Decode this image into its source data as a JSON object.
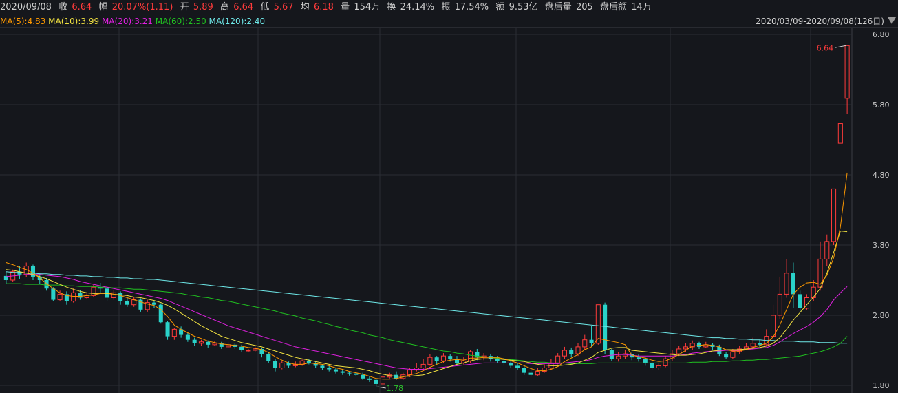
{
  "header": {
    "date": "2020/09/08",
    "close_label": "收",
    "close": "6.64",
    "chg_label": "幅",
    "chg": "20.07%(1.11)",
    "open_label": "开",
    "open": "5.89",
    "high_label": "高",
    "high": "6.64",
    "low_label": "低",
    "low": "5.67",
    "avg_label": "均",
    "avg": "6.18",
    "vol_label": "量",
    "vol": "154万",
    "turnover_label": "换",
    "turnover": "24.14%",
    "amp_label": "振",
    "amp": "17.54%",
    "amount_label": "额",
    "amount": "9.53亿",
    "after_vol_label": "盘后量",
    "after_vol": "205",
    "after_amt_label": "盘后额",
    "after_amt": "14万"
  },
  "ma_legend": [
    {
      "text": "MA(5):4.83",
      "color": "#ff9900"
    },
    {
      "text": "MA(10):3.99",
      "color": "#f0e040"
    },
    {
      "text": "MA(20):3.21",
      "color": "#e020e0"
    },
    {
      "text": "MA(60):2.50",
      "color": "#20c020"
    },
    {
      "text": "MA(120):2.40",
      "color": "#6ee8e8"
    }
  ],
  "range_label": "2020/03/09-2020/09/08(126日)",
  "colors": {
    "up": "#ff3b3b",
    "down": "#2ad2c9",
    "grid": "#2a2d34"
  },
  "chart_data": {
    "type": "candlestick",
    "ylim": [
      1.78,
      6.82
    ],
    "yticks": [
      "6.80",
      "5.80",
      "4.80",
      "3.80",
      "2.80",
      "1.80"
    ],
    "max_label": "6.64",
    "min_label": "1.78",
    "candles": [
      [
        3.36,
        3.3,
        3.42,
        3.25
      ],
      [
        3.3,
        3.42,
        3.45,
        3.28
      ],
      [
        3.42,
        3.38,
        3.5,
        3.32
      ],
      [
        3.38,
        3.5,
        3.55,
        3.34
      ],
      [
        3.5,
        3.35,
        3.52,
        3.3
      ],
      [
        3.35,
        3.3,
        3.4,
        3.25
      ],
      [
        3.3,
        3.18,
        3.33,
        3.15
      ],
      [
        3.18,
        3.02,
        3.2,
        3.0
      ],
      [
        3.02,
        3.1,
        3.15,
        3.0
      ],
      [
        3.1,
        3.0,
        3.14,
        2.95
      ],
      [
        3.0,
        3.12,
        3.18,
        2.98
      ],
      [
        3.12,
        3.05,
        3.16,
        3.02
      ],
      [
        3.05,
        3.08,
        3.12,
        3.03
      ],
      [
        3.08,
        3.2,
        3.24,
        3.06
      ],
      [
        3.2,
        3.18,
        3.26,
        3.12
      ],
      [
        3.18,
        3.05,
        3.2,
        3.0
      ],
      [
        3.05,
        3.12,
        3.16,
        3.02
      ],
      [
        3.12,
        3.0,
        3.14,
        2.95
      ],
      [
        3.0,
        2.95,
        3.05,
        2.92
      ],
      [
        2.95,
        3.02,
        3.06,
        2.92
      ],
      [
        3.02,
        2.88,
        3.04,
        2.85
      ],
      [
        2.88,
        2.98,
        3.02,
        2.85
      ],
      [
        2.98,
        2.95,
        3.0,
        2.9
      ],
      [
        2.95,
        2.7,
        2.97,
        2.68
      ],
      [
        2.7,
        2.5,
        2.72,
        2.45
      ],
      [
        2.5,
        2.6,
        2.62,
        2.45
      ],
      [
        2.6,
        2.52,
        2.64,
        2.48
      ],
      [
        2.52,
        2.45,
        2.55,
        2.42
      ],
      [
        2.45,
        2.4,
        2.48,
        2.36
      ],
      [
        2.4,
        2.42,
        2.45,
        2.36
      ],
      [
        2.42,
        2.38,
        2.44,
        2.34
      ],
      [
        2.38,
        2.4,
        2.43,
        2.36
      ],
      [
        2.4,
        2.35,
        2.42,
        2.32
      ],
      [
        2.35,
        2.38,
        2.42,
        2.33
      ],
      [
        2.38,
        2.35,
        2.4,
        2.32
      ],
      [
        2.35,
        2.3,
        2.38,
        2.28
      ],
      [
        2.3,
        2.3,
        2.32,
        2.27
      ],
      [
        2.3,
        2.32,
        2.36,
        2.28
      ],
      [
        2.32,
        2.25,
        2.34,
        2.2
      ],
      [
        2.25,
        2.15,
        2.27,
        2.12
      ],
      [
        2.15,
        2.05,
        2.18,
        2.0
      ],
      [
        2.05,
        2.12,
        2.15,
        2.03
      ],
      [
        2.12,
        2.08,
        2.14,
        2.05
      ],
      [
        2.08,
        2.1,
        2.14,
        2.06
      ],
      [
        2.1,
        2.15,
        2.17,
        2.08
      ],
      [
        2.15,
        2.12,
        2.18,
        2.1
      ],
      [
        2.12,
        2.08,
        2.14,
        2.05
      ],
      [
        2.08,
        2.05,
        2.1,
        2.02
      ],
      [
        2.05,
        2.03,
        2.08,
        2.0
      ],
      [
        2.03,
        2.0,
        2.05,
        1.97
      ],
      [
        2.0,
        1.98,
        2.02,
        1.95
      ],
      [
        1.98,
        1.97,
        2.0,
        1.94
      ],
      [
        1.97,
        1.95,
        1.99,
        1.93
      ],
      [
        1.95,
        1.9,
        1.98,
        1.88
      ],
      [
        1.9,
        1.88,
        1.93,
        1.85
      ],
      [
        1.88,
        1.82,
        1.9,
        1.78
      ],
      [
        1.82,
        1.92,
        1.95,
        1.8
      ],
      [
        1.92,
        1.95,
        1.98,
        1.9
      ],
      [
        1.95,
        1.9,
        2.0,
        1.88
      ],
      [
        1.9,
        1.95,
        1.98,
        1.88
      ],
      [
        1.95,
        2.02,
        2.05,
        1.92
      ],
      [
        2.02,
        2.05,
        2.12,
        2.0
      ],
      [
        2.05,
        2.1,
        2.18,
        2.03
      ],
      [
        2.1,
        2.2,
        2.25,
        2.08
      ],
      [
        2.2,
        2.15,
        2.22,
        2.1
      ],
      [
        2.15,
        2.22,
        2.26,
        2.12
      ],
      [
        2.22,
        2.18,
        2.25,
        2.14
      ],
      [
        2.18,
        2.12,
        2.22,
        2.08
      ],
      [
        2.12,
        2.15,
        2.2,
        2.1
      ],
      [
        2.15,
        2.28,
        2.3,
        2.12
      ],
      [
        2.28,
        2.2,
        2.32,
        2.16
      ],
      [
        2.2,
        2.22,
        2.26,
        2.16
      ],
      [
        2.22,
        2.18,
        2.25,
        2.14
      ],
      [
        2.18,
        2.15,
        2.22,
        2.12
      ],
      [
        2.15,
        2.12,
        2.18,
        2.08
      ],
      [
        2.12,
        2.08,
        2.15,
        2.05
      ],
      [
        2.08,
        2.05,
        2.12,
        2.02
      ],
      [
        2.05,
        1.98,
        2.08,
        1.95
      ],
      [
        1.98,
        1.95,
        2.02,
        1.92
      ],
      [
        1.95,
        2.0,
        2.05,
        1.93
      ],
      [
        2.0,
        2.05,
        2.1,
        1.98
      ],
      [
        2.05,
        2.12,
        2.18,
        2.03
      ],
      [
        2.12,
        2.22,
        2.26,
        2.1
      ],
      [
        2.22,
        2.3,
        2.35,
        2.18
      ],
      [
        2.3,
        2.25,
        2.34,
        2.2
      ],
      [
        2.25,
        2.35,
        2.4,
        2.22
      ],
      [
        2.35,
        2.45,
        2.52,
        2.3
      ],
      [
        2.45,
        2.4,
        2.65,
        2.35
      ],
      [
        2.4,
        2.95,
        2.95,
        2.38
      ],
      [
        2.95,
        2.3,
        2.98,
        2.25
      ],
      [
        2.3,
        2.18,
        2.32,
        2.15
      ],
      [
        2.18,
        2.22,
        2.28,
        2.14
      ],
      [
        2.22,
        2.25,
        2.3,
        2.18
      ],
      [
        2.25,
        2.2,
        2.28,
        2.16
      ],
      [
        2.2,
        2.18,
        2.24,
        2.14
      ],
      [
        2.18,
        2.12,
        2.2,
        2.08
      ],
      [
        2.12,
        2.05,
        2.15,
        2.02
      ],
      [
        2.05,
        2.08,
        2.12,
        2.02
      ],
      [
        2.08,
        2.18,
        2.22,
        2.06
      ],
      [
        2.18,
        2.25,
        2.3,
        2.15
      ],
      [
        2.25,
        2.32,
        2.36,
        2.22
      ],
      [
        2.32,
        2.35,
        2.4,
        2.28
      ],
      [
        2.35,
        2.4,
        2.44,
        2.3
      ],
      [
        2.4,
        2.35,
        2.42,
        2.32
      ],
      [
        2.35,
        2.38,
        2.42,
        2.33
      ],
      [
        2.38,
        2.35,
        2.4,
        2.3
      ],
      [
        2.35,
        2.25,
        2.38,
        2.22
      ],
      [
        2.25,
        2.2,
        2.28,
        2.18
      ],
      [
        2.2,
        2.28,
        2.32,
        2.18
      ],
      [
        2.28,
        2.32,
        2.36,
        2.25
      ],
      [
        2.32,
        2.35,
        2.4,
        2.3
      ],
      [
        2.35,
        2.4,
        2.48,
        2.33
      ],
      [
        2.4,
        2.38,
        2.45,
        2.35
      ],
      [
        2.38,
        2.5,
        2.6,
        2.36
      ],
      [
        2.5,
        2.8,
        2.95,
        2.48
      ],
      [
        2.8,
        3.1,
        3.35,
        2.75
      ],
      [
        3.1,
        3.4,
        3.6,
        3.05
      ],
      [
        3.4,
        3.1,
        3.55,
        2.9
      ],
      [
        3.1,
        2.9,
        3.15,
        2.85
      ],
      [
        2.9,
        3.05,
        3.1,
        2.88
      ],
      [
        3.05,
        3.2,
        3.3,
        3.0
      ],
      [
        3.2,
        3.6,
        3.85,
        3.15
      ],
      [
        3.6,
        3.85,
        3.95,
        3.5
      ],
      [
        3.85,
        4.6,
        4.6,
        3.8
      ],
      [
        5.25,
        5.53,
        5.53,
        5.25
      ],
      [
        5.89,
        6.64,
        6.64,
        5.67
      ]
    ],
    "ma5": [
      3.55,
      3.52,
      3.48,
      3.45,
      3.4,
      3.33,
      3.25,
      3.18,
      3.12,
      3.08,
      3.07,
      3.07,
      3.08,
      3.09,
      3.11,
      3.12,
      3.1,
      3.08,
      3.05,
      3.02,
      2.99,
      2.96,
      2.94,
      2.88,
      2.78,
      2.66,
      2.6,
      2.55,
      2.5,
      2.47,
      2.43,
      2.41,
      2.39,
      2.38,
      2.37,
      2.36,
      2.34,
      2.33,
      2.31,
      2.27,
      2.21,
      2.16,
      2.12,
      2.1,
      2.1,
      2.12,
      2.11,
      2.1,
      2.08,
      2.05,
      2.03,
      2.0,
      1.98,
      1.96,
      1.93,
      1.9,
      1.89,
      1.89,
      1.9,
      1.92,
      1.95,
      1.97,
      2.01,
      2.06,
      2.1,
      2.14,
      2.16,
      2.17,
      2.16,
      2.19,
      2.19,
      2.2,
      2.2,
      2.2,
      2.18,
      2.15,
      2.12,
      2.08,
      2.04,
      2.01,
      2.01,
      2.03,
      2.07,
      2.14,
      2.19,
      2.24,
      2.31,
      2.35,
      2.47,
      2.45,
      2.43,
      2.41,
      2.38,
      2.23,
      2.21,
      2.19,
      2.16,
      2.14,
      2.15,
      2.19,
      2.24,
      2.3,
      2.36,
      2.37,
      2.38,
      2.37,
      2.35,
      2.31,
      2.29,
      2.29,
      2.31,
      2.34,
      2.37,
      2.4,
      2.49,
      2.66,
      2.88,
      3.1,
      3.2,
      3.26,
      3.27,
      3.24,
      3.37,
      3.62,
      4.06,
      4.83
    ],
    "ma10": [
      3.45,
      3.44,
      3.42,
      3.4,
      3.38,
      3.35,
      3.32,
      3.28,
      3.24,
      3.2,
      3.17,
      3.14,
      3.12,
      3.11,
      3.11,
      3.11,
      3.1,
      3.09,
      3.08,
      3.06,
      3.05,
      3.03,
      3.01,
      2.98,
      2.94,
      2.89,
      2.83,
      2.77,
      2.71,
      2.65,
      2.6,
      2.55,
      2.5,
      2.47,
      2.44,
      2.41,
      2.39,
      2.37,
      2.35,
      2.32,
      2.29,
      2.26,
      2.23,
      2.2,
      2.18,
      2.16,
      2.14,
      2.12,
      2.1,
      2.08,
      2.07,
      2.06,
      2.05,
      2.03,
      2.01,
      1.98,
      1.96,
      1.94,
      1.93,
      1.93,
      1.93,
      1.94,
      1.95,
      1.98,
      2.01,
      2.04,
      2.07,
      2.1,
      2.12,
      2.15,
      2.17,
      2.18,
      2.18,
      2.18,
      2.17,
      2.16,
      2.15,
      2.14,
      2.12,
      2.1,
      2.09,
      2.08,
      2.08,
      2.09,
      2.1,
      2.12,
      2.16,
      2.2,
      2.27,
      2.3,
      2.33,
      2.34,
      2.34,
      2.3,
      2.29,
      2.28,
      2.27,
      2.26,
      2.25,
      2.24,
      2.23,
      2.23,
      2.24,
      2.25,
      2.27,
      2.29,
      2.3,
      2.31,
      2.31,
      2.31,
      2.32,
      2.33,
      2.34,
      2.36,
      2.4,
      2.48,
      2.6,
      2.73,
      2.84,
      2.95,
      3.06,
      3.18,
      3.4,
      3.7,
      4.0,
      3.99
    ],
    "ma20": [
      3.35,
      3.36,
      3.37,
      3.38,
      3.38,
      3.38,
      3.37,
      3.36,
      3.35,
      3.33,
      3.31,
      3.28,
      3.26,
      3.24,
      3.22,
      3.2,
      3.18,
      3.16,
      3.14,
      3.12,
      3.1,
      3.08,
      3.06,
      3.04,
      3.01,
      2.97,
      2.93,
      2.89,
      2.85,
      2.81,
      2.77,
      2.73,
      2.69,
      2.65,
      2.62,
      2.59,
      2.56,
      2.53,
      2.5,
      2.47,
      2.44,
      2.41,
      2.38,
      2.35,
      2.33,
      2.31,
      2.29,
      2.27,
      2.25,
      2.23,
      2.21,
      2.19,
      2.17,
      2.15,
      2.13,
      2.11,
      2.09,
      2.07,
      2.05,
      2.04,
      2.03,
      2.03,
      2.03,
      2.04,
      2.05,
      2.06,
      2.07,
      2.08,
      2.09,
      2.1,
      2.11,
      2.12,
      2.12,
      2.12,
      2.12,
      2.12,
      2.12,
      2.12,
      2.11,
      2.11,
      2.11,
      2.11,
      2.11,
      2.12,
      2.13,
      2.14,
      2.15,
      2.17,
      2.2,
      2.22,
      2.23,
      2.24,
      2.24,
      2.23,
      2.22,
      2.22,
      2.22,
      2.22,
      2.22,
      2.22,
      2.23,
      2.24,
      2.26,
      2.27,
      2.28,
      2.29,
      2.29,
      2.3,
      2.3,
      2.3,
      2.31,
      2.32,
      2.33,
      2.34,
      2.37,
      2.42,
      2.48,
      2.54,
      2.59,
      2.64,
      2.7,
      2.78,
      2.88,
      3.02,
      3.12,
      3.21
    ],
    "ma60": [
      3.25,
      3.25,
      3.25,
      3.24,
      3.24,
      3.24,
      3.23,
      3.23,
      3.23,
      3.22,
      3.22,
      3.21,
      3.21,
      3.21,
      3.2,
      3.2,
      3.19,
      3.19,
      3.18,
      3.17,
      3.17,
      3.16,
      3.15,
      3.14,
      3.13,
      3.12,
      3.11,
      3.09,
      3.08,
      3.06,
      3.05,
      3.03,
      3.01,
      3.0,
      2.98,
      2.96,
      2.94,
      2.92,
      2.9,
      2.88,
      2.86,
      2.83,
      2.81,
      2.79,
      2.76,
      2.74,
      2.72,
      2.69,
      2.67,
      2.64,
      2.62,
      2.59,
      2.57,
      2.55,
      2.52,
      2.5,
      2.48,
      2.45,
      2.43,
      2.41,
      2.39,
      2.37,
      2.35,
      2.33,
      2.31,
      2.29,
      2.28,
      2.26,
      2.25,
      2.23,
      2.22,
      2.21,
      2.2,
      2.19,
      2.18,
      2.17,
      2.16,
      2.15,
      2.14,
      2.13,
      2.13,
      2.12,
      2.12,
      2.12,
      2.11,
      2.11,
      2.11,
      2.11,
      2.12,
      2.12,
      2.12,
      2.12,
      2.12,
      2.12,
      2.12,
      2.12,
      2.12,
      2.12,
      2.12,
      2.12,
      2.12,
      2.12,
      2.13,
      2.13,
      2.13,
      2.14,
      2.14,
      2.14,
      2.15,
      2.15,
      2.16,
      2.16,
      2.17,
      2.17,
      2.18,
      2.19,
      2.2,
      2.21,
      2.22,
      2.24,
      2.26,
      2.28,
      2.31,
      2.35,
      2.4,
      2.5
    ],
    "ma120": [
      3.42,
      3.41,
      3.41,
      3.4,
      3.4,
      3.39,
      3.39,
      3.38,
      3.38,
      3.37,
      3.37,
      3.36,
      3.36,
      3.35,
      3.35,
      3.34,
      3.34,
      3.33,
      3.33,
      3.32,
      3.32,
      3.31,
      3.31,
      3.3,
      3.29,
      3.28,
      3.27,
      3.26,
      3.25,
      3.24,
      3.23,
      3.22,
      3.21,
      3.2,
      3.19,
      3.18,
      3.17,
      3.16,
      3.15,
      3.14,
      3.13,
      3.12,
      3.11,
      3.1,
      3.09,
      3.08,
      3.07,
      3.06,
      3.05,
      3.04,
      3.03,
      3.02,
      3.01,
      3.0,
      2.99,
      2.98,
      2.97,
      2.96,
      2.95,
      2.94,
      2.93,
      2.92,
      2.91,
      2.9,
      2.89,
      2.88,
      2.87,
      2.86,
      2.85,
      2.84,
      2.83,
      2.82,
      2.81,
      2.8,
      2.79,
      2.78,
      2.77,
      2.76,
      2.75,
      2.74,
      2.73,
      2.72,
      2.71,
      2.7,
      2.69,
      2.68,
      2.67,
      2.66,
      2.65,
      2.64,
      2.63,
      2.62,
      2.61,
      2.6,
      2.59,
      2.58,
      2.57,
      2.56,
      2.55,
      2.54,
      2.53,
      2.52,
      2.51,
      2.5,
      2.49,
      2.48,
      2.48,
      2.47,
      2.47,
      2.46,
      2.46,
      2.45,
      2.45,
      2.44,
      2.44,
      2.43,
      2.43,
      2.43,
      2.42,
      2.42,
      2.42,
      2.41,
      2.41,
      2.41,
      2.4,
      2.4
    ]
  }
}
